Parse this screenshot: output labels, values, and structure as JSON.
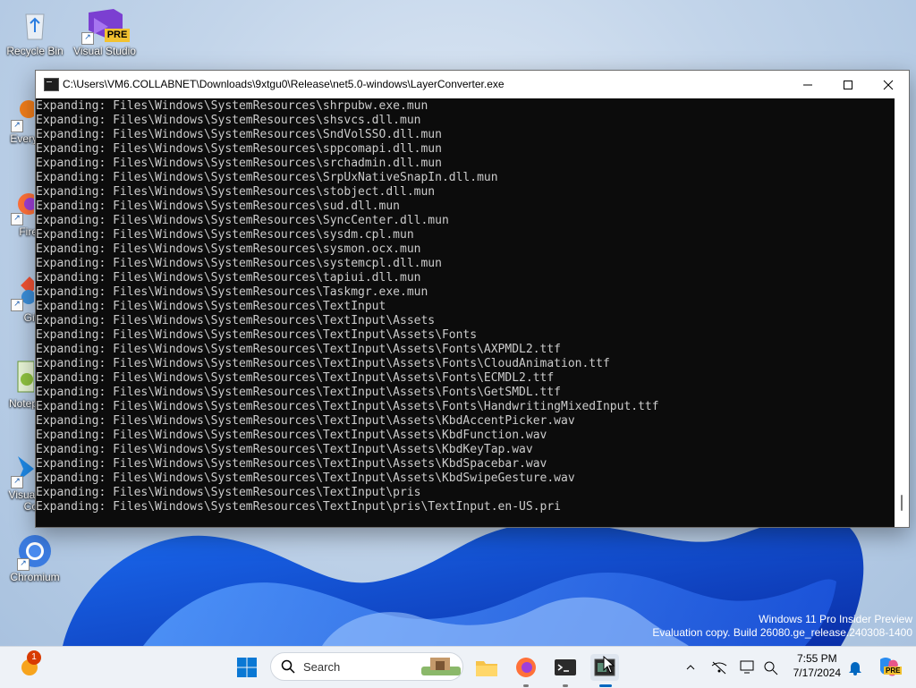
{
  "desktop": {
    "icons": [
      {
        "label": "Recycle Bin"
      },
      {
        "label": "Visual Studio"
      },
      {
        "label": "Every"
      },
      {
        "label": "Fire"
      },
      {
        "label": "Git"
      },
      {
        "label": "Notep"
      },
      {
        "label": "Visual"
      },
      {
        "label": "Co"
      },
      {
        "label": "Chromium"
      }
    ],
    "vs_badge": "PRE"
  },
  "window": {
    "title": "C:\\Users\\VM6.COLLABNET\\Downloads\\9xtgu0\\Release\\net5.0-windows\\LayerConverter.exe",
    "lines": [
      "Expanding: Files\\Windows\\SystemResources\\shrpubw.exe.mun",
      "Expanding: Files\\Windows\\SystemResources\\shsvcs.dll.mun",
      "Expanding: Files\\Windows\\SystemResources\\SndVolSSO.dll.mun",
      "Expanding: Files\\Windows\\SystemResources\\sppcomapi.dll.mun",
      "Expanding: Files\\Windows\\SystemResources\\srchadmin.dll.mun",
      "Expanding: Files\\Windows\\SystemResources\\SrpUxNativeSnapIn.dll.mun",
      "Expanding: Files\\Windows\\SystemResources\\stobject.dll.mun",
      "Expanding: Files\\Windows\\SystemResources\\sud.dll.mun",
      "Expanding: Files\\Windows\\SystemResources\\SyncCenter.dll.mun",
      "Expanding: Files\\Windows\\SystemResources\\sysdm.cpl.mun",
      "Expanding: Files\\Windows\\SystemResources\\sysmon.ocx.mun",
      "Expanding: Files\\Windows\\SystemResources\\systemcpl.dll.mun",
      "Expanding: Files\\Windows\\SystemResources\\tapiui.dll.mun",
      "Expanding: Files\\Windows\\SystemResources\\Taskmgr.exe.mun",
      "Expanding: Files\\Windows\\SystemResources\\TextInput",
      "Expanding: Files\\Windows\\SystemResources\\TextInput\\Assets",
      "Expanding: Files\\Windows\\SystemResources\\TextInput\\Assets\\Fonts",
      "Expanding: Files\\Windows\\SystemResources\\TextInput\\Assets\\Fonts\\AXPMDL2.ttf",
      "Expanding: Files\\Windows\\SystemResources\\TextInput\\Assets\\Fonts\\CloudAnimation.ttf",
      "Expanding: Files\\Windows\\SystemResources\\TextInput\\Assets\\Fonts\\ECMDL2.ttf",
      "Expanding: Files\\Windows\\SystemResources\\TextInput\\Assets\\Fonts\\GetSMDL.ttf",
      "Expanding: Files\\Windows\\SystemResources\\TextInput\\Assets\\Fonts\\HandwritingMixedInput.ttf",
      "Expanding: Files\\Windows\\SystemResources\\TextInput\\Assets\\KbdAccentPicker.wav",
      "Expanding: Files\\Windows\\SystemResources\\TextInput\\Assets\\KbdFunction.wav",
      "Expanding: Files\\Windows\\SystemResources\\TextInput\\Assets\\KbdKeyTap.wav",
      "Expanding: Files\\Windows\\SystemResources\\TextInput\\Assets\\KbdSpacebar.wav",
      "Expanding: Files\\Windows\\SystemResources\\TextInput\\Assets\\KbdSwipeGesture.wav",
      "Expanding: Files\\Windows\\SystemResources\\TextInput\\pris",
      "Expanding: Files\\Windows\\SystemResources\\TextInput\\pris\\TextInput.en-US.pri"
    ]
  },
  "watermark": {
    "line1": "Windows 11 Pro Insider Preview",
    "line2": "Evaluation copy. Build 26080.ge_release.240308-1400"
  },
  "taskbar": {
    "search_label": "Search",
    "notification_count": "1",
    "time": "7:55 PM",
    "date": "7/17/2024",
    "copilot_badge": "PRE"
  },
  "colors": {
    "console_bg": "#0c0c0c",
    "console_text": "#cccccc",
    "accent": "#0067c0"
  }
}
